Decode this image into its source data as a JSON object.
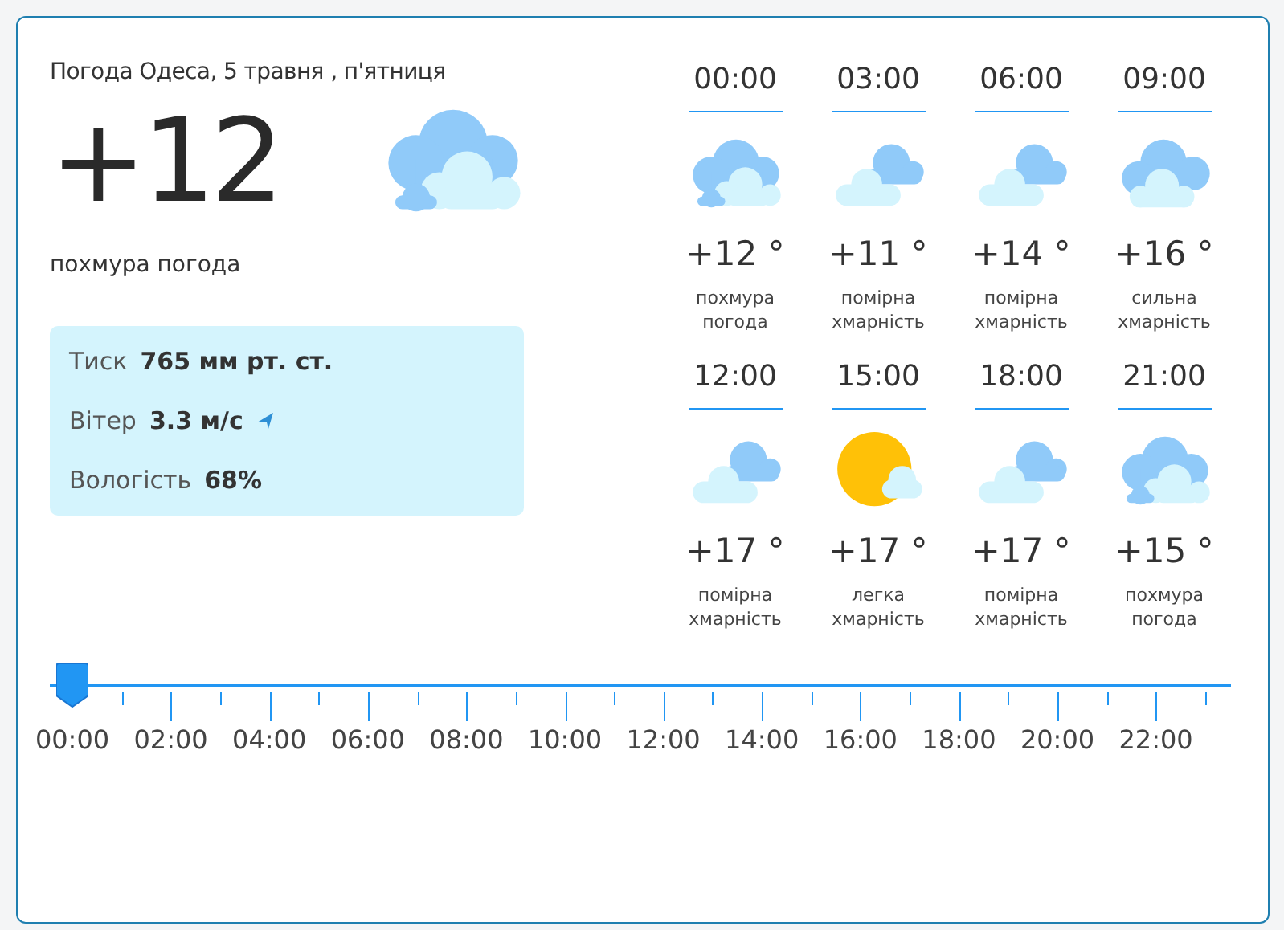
{
  "title": "Погода Одеса, 5 травня , п'ятниця",
  "current": {
    "temperature": "+12",
    "kind": "overcast",
    "description": "похмура погода"
  },
  "details": [
    {
      "label": "Тиск",
      "value": "765 мм рт. ст."
    },
    {
      "label": "Вітер",
      "value": "3.3 м/с",
      "kind": "wind"
    },
    {
      "label": "Вологість",
      "value": "68%"
    }
  ],
  "forecast": [
    {
      "time": "00:00",
      "kind": "overcast",
      "temperature": "+12 °",
      "description": "похмура погода"
    },
    {
      "time": "03:00",
      "kind": "partly",
      "temperature": "+11 °",
      "description": "помірна хмарність"
    },
    {
      "time": "06:00",
      "kind": "partly",
      "temperature": "+14 °",
      "description": "помірна хмарність"
    },
    {
      "time": "09:00",
      "kind": "heavy",
      "temperature": "+16 °",
      "description": "сильна хмарність"
    },
    {
      "time": "12:00",
      "kind": "partly",
      "temperature": "+17 °",
      "description": "помірна хмарність"
    },
    {
      "time": "15:00",
      "kind": "sun",
      "temperature": "+17 °",
      "description": "легка хмарність"
    },
    {
      "time": "18:00",
      "kind": "partly",
      "temperature": "+17 °",
      "description": "помірна хмарність"
    },
    {
      "time": "21:00",
      "kind": "overcast",
      "temperature": "+15 °",
      "description": "похмура погода"
    }
  ],
  "timeline": {
    "level": 0,
    "labels": [
      "00:00",
      "02:00",
      "04:00",
      "06:00",
      "08:00",
      "10:00",
      "12:00",
      "14:00",
      "16:00",
      "18:00",
      "20:00",
      "22:00"
    ]
  }
}
